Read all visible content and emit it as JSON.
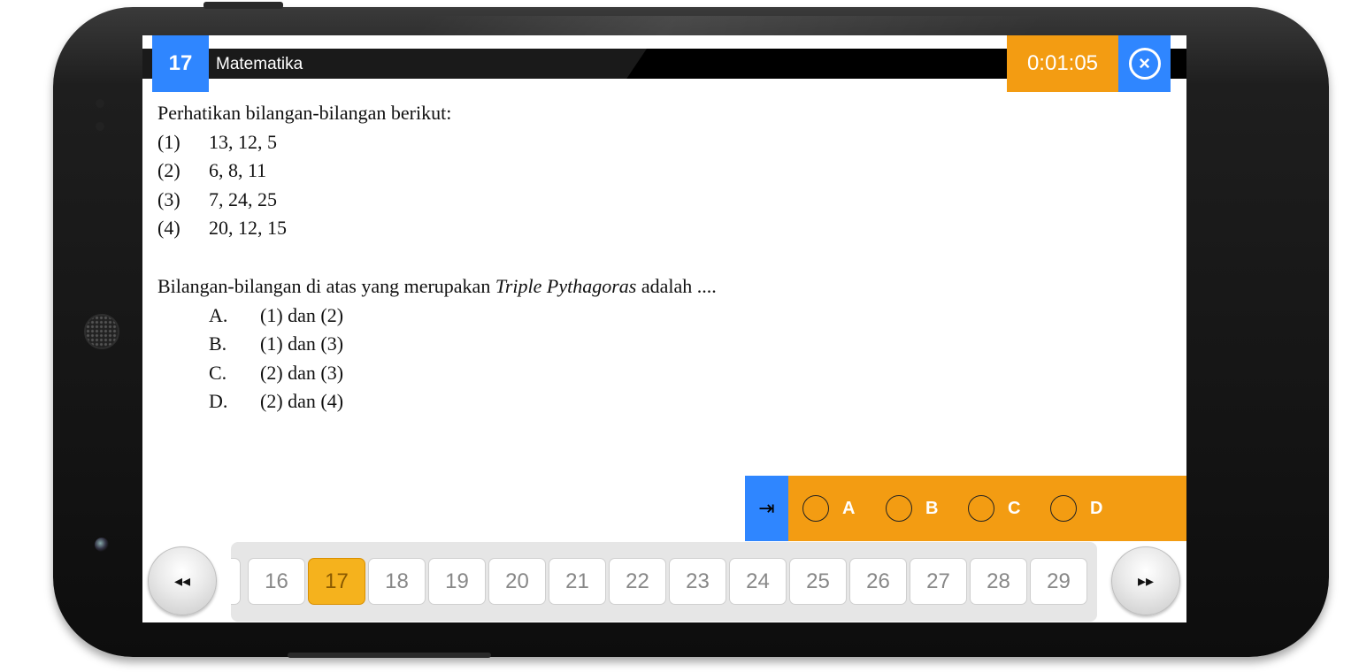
{
  "header": {
    "question_number": "17",
    "subject": "Matematika",
    "timer": "0:01:05",
    "close_glyph": "×"
  },
  "question": {
    "intro": "Perhatikan bilangan-bilangan berikut:",
    "items": [
      {
        "num": "(1)",
        "text": "13, 12, 5"
      },
      {
        "num": "(2)",
        "text": "6, 8, 11"
      },
      {
        "num": "(3)",
        "text": "7, 24, 25"
      },
      {
        "num": "(4)",
        "text": "20, 12, 15"
      }
    ],
    "prompt_before": "Bilangan-bilangan di atas yang merupakan ",
    "prompt_italic": "Triple Pythagoras",
    "prompt_after": " adalah ....",
    "options": [
      {
        "label": "A.",
        "text": "(1) dan (2)"
      },
      {
        "label": "B.",
        "text": "(1) dan (3)"
      },
      {
        "label": "C.",
        "text": "(2) dan (3)"
      },
      {
        "label": "D.",
        "text": "(2) dan (4)"
      }
    ]
  },
  "answer_bar": {
    "jump_glyph": "⇥",
    "choices": [
      "A",
      "B",
      "C",
      "D"
    ],
    "selected": null
  },
  "pager": {
    "prev_glyph": "◂◂",
    "next_glyph": "▸▸",
    "pages": [
      "16",
      "17",
      "18",
      "19",
      "20",
      "21",
      "22",
      "23",
      "24",
      "25",
      "26",
      "27",
      "28",
      "29"
    ],
    "active": "17"
  },
  "colors": {
    "accent_blue": "#2f86ff",
    "accent_orange": "#f39c12",
    "active_page": "#f5b21d"
  }
}
